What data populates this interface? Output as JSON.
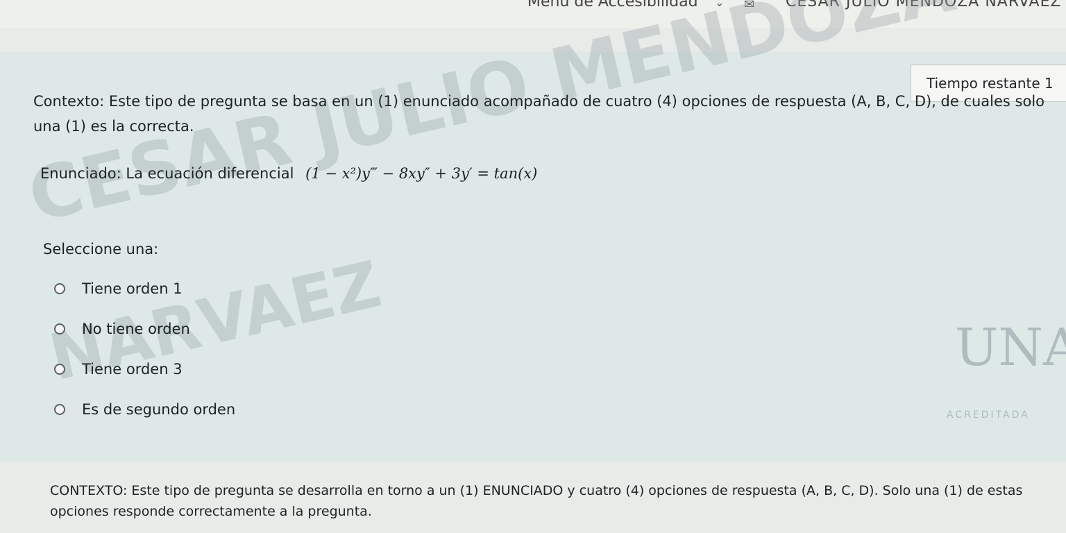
{
  "header": {
    "access_menu": "Menú de Accesibilidad",
    "chevron_glyph": "⌄",
    "user_name": "CESAR JULIO MENDOZA NARVAEZ"
  },
  "timer": {
    "label": "Tiempo restante 1"
  },
  "question": {
    "context": "Contexto: Este tipo de pregunta se basa en un (1) enunciado acompañado de cuatro (4) opciones de respuesta (A, B, C, D), de cuales solo una (1) es la correcta.",
    "statement_label": "Enunciado: La ecuación diferencial",
    "equation": "(1 − x²)y‴ − 8xy″ + 3y′ = tan(x)",
    "select_label": "Seleccione una:",
    "options": [
      {
        "label": "Tiene orden 1"
      },
      {
        "label": "No tiene orden"
      },
      {
        "label": "Tiene orden 3"
      },
      {
        "label": "Es de segundo orden"
      }
    ]
  },
  "watermark": {
    "line1": "CESAR JULIO MENDOZA",
    "line2": "NARVAEZ"
  },
  "logo": {
    "mark": "UNAD",
    "accreditation": "ACREDITADA"
  },
  "next_question": {
    "context": "CONTEXTO: Este tipo de pregunta se desarrolla en torno a un (1) ENUNCIADO y cuatro (4) opciones de respuesta (A, B, C, D). Solo una (1) de estas opciones responde correctamente a la pregunta."
  }
}
